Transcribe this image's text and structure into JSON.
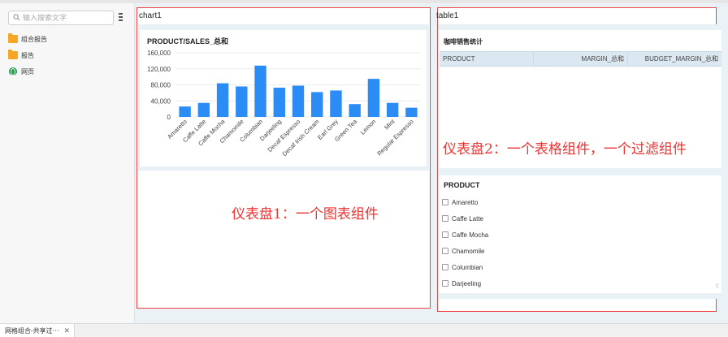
{
  "sidebar": {
    "search_placeholder": "输入搜索文字",
    "items": [
      {
        "label": "组合报告",
        "icon": "folder-icon"
      },
      {
        "label": "报告",
        "icon": "folder-icon"
      },
      {
        "label": "网页",
        "icon": "globe-icon"
      }
    ]
  },
  "chart_panel": {
    "name": "chart1",
    "annotation": "仪表盘1：一个图表组件"
  },
  "chart_data": {
    "type": "bar",
    "title": "PRODUCT/SALES_总和",
    "categories": [
      "Amaretto",
      "Caffe Latte",
      "Caffe Mocha",
      "Chamomile",
      "Columbian",
      "Darjeeling",
      "Decaf Espresso",
      "Decaf Irish Cream",
      "Earl Grey",
      "Green Tea",
      "Lemon",
      "Mint",
      "Regular Espresso"
    ],
    "values": [
      26000,
      35000,
      84000,
      76000,
      128000,
      73000,
      78000,
      62000,
      66000,
      32000,
      95000,
      35000,
      23000
    ],
    "ylim": [
      0,
      160000
    ],
    "yticks": [
      "160,000",
      "120,000",
      "80,000",
      "40,000",
      "0"
    ],
    "color": "#2b8cf5",
    "grid": true
  },
  "table_panel": {
    "name": "table1",
    "title": "咖啡销售统计",
    "columns": [
      "PRODUCT",
      "MARGIN_总和",
      "BUDGET_MARGIN_总和"
    ],
    "annotation": "仪表盘2：一个表格组件，一个过滤组件"
  },
  "filter": {
    "title": "PRODUCT",
    "options": [
      "Amaretto",
      "Caffe Latte",
      "Caffe Mocha",
      "Chamomile",
      "Columbian",
      "Darjeeling"
    ]
  },
  "bottom_tab": {
    "label": "网格组合-共享过⋯",
    "close": "✕"
  }
}
